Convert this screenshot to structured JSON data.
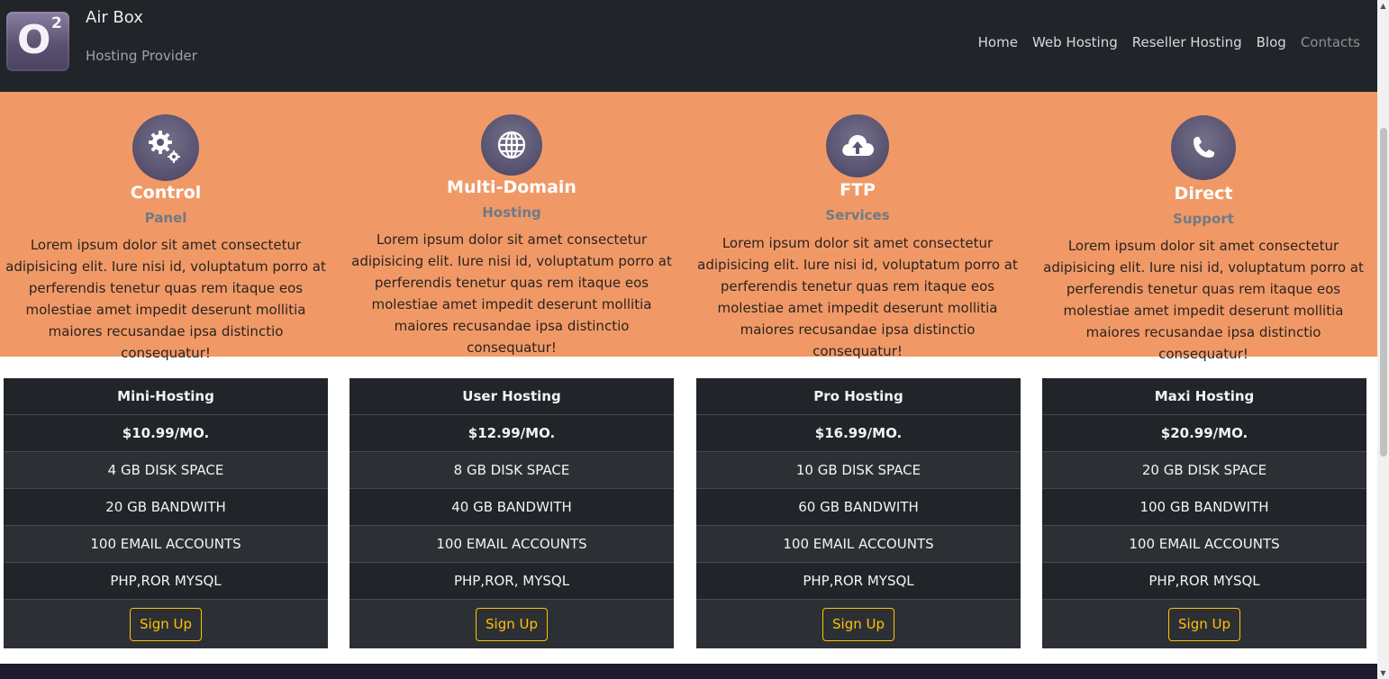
{
  "brand": {
    "name": "Air Box",
    "tagline": "Hosting Provider",
    "logo_text": "O",
    "logo_sup": "2"
  },
  "nav": {
    "items": [
      {
        "label": "Home"
      },
      {
        "label": "Web Hosting"
      },
      {
        "label": "Reseller Hosting"
      },
      {
        "label": "Blog"
      },
      {
        "label": "Contacts"
      }
    ]
  },
  "features": [
    {
      "icon": "gears-icon",
      "title": "Control",
      "subtitle": "Panel",
      "description": "Lorem ipsum dolor sit amet consectetur adipisicing elit. Iure nisi id, voluptatum porro at perferendis tenetur quas rem itaque eos molestiae amet impedit deserunt mollitia maiores recusandae ipsa distinctio consequatur!"
    },
    {
      "icon": "globe-icon",
      "title": "Multi-Domain",
      "subtitle": "Hosting",
      "description": "Lorem ipsum dolor sit amet consectetur adipisicing elit. Iure nisi id, voluptatum porro at perferendis tenetur quas rem itaque eos molestiae amet impedit deserunt mollitia maiores recusandae ipsa distinctio consequatur!"
    },
    {
      "icon": "cloud-upload-icon",
      "title": "FTP",
      "subtitle": "Services",
      "description": "Lorem ipsum dolor sit amet consectetur adipisicing elit. Iure nisi id, voluptatum porro at perferendis tenetur quas rem itaque eos molestiae amet impedit deserunt mollitia maiores recusandae ipsa distinctio consequatur!"
    },
    {
      "icon": "phone-icon",
      "title": "Direct",
      "subtitle": "Support",
      "description": "Lorem ipsum dolor sit amet consectetur adipisicing elit. Iure nisi id, voluptatum porro at perferendis tenetur quas rem itaque eos molestiae amet impedit deserunt mollitia maiores recusandae ipsa distinctio consequatur!"
    }
  ],
  "plans": [
    {
      "name": "Mini-Hosting",
      "price": "$10.99/MO.",
      "disk": "4 GB DISK SPACE",
      "bandwidth": "20 GB BANDWITH",
      "email": "100 EMAIL ACCOUNTS",
      "tech": "PHP,ROR MYSQL",
      "button": "Sign Up"
    },
    {
      "name": "User Hosting",
      "price": "$12.99/MO.",
      "disk": "8 GB DISK SPACE",
      "bandwidth": "40 GB BANDWITH",
      "email": "100 EMAIL ACCOUNTS",
      "tech": "PHP,ROR, MYSQL",
      "button": "Sign Up"
    },
    {
      "name": "Pro Hosting",
      "price": "$16.99/MO.",
      "disk": "10 GB DISK SPACE",
      "bandwidth": "60 GB BANDWITH",
      "email": "100 EMAIL ACCOUNTS",
      "tech": "PHP,ROR MYSQL",
      "button": "Sign Up"
    },
    {
      "name": "Maxi Hosting",
      "price": "$20.99/MO.",
      "disk": "20 GB DISK SPACE",
      "bandwidth": "100 GB BANDWITH",
      "email": "100 EMAIL ACCOUNTS",
      "tech": "PHP,ROR MYSQL",
      "button": "Sign Up"
    }
  ],
  "colors": {
    "navbar": "#212529",
    "features_bg": "#f19966",
    "table_dark": "#212529",
    "table_light": "#2c3035",
    "button_accent": "#ffc107"
  }
}
